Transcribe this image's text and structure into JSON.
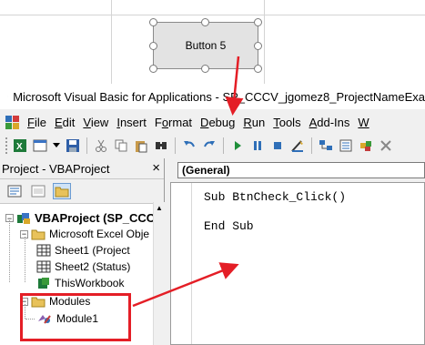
{
  "excel": {
    "button_label": "Button 5"
  },
  "vbe": {
    "title": "Microsoft Visual Basic for Applications - SP_CCCV_jgomez8_ProjectNameExa",
    "menu": [
      {
        "label": "File",
        "accel": "F",
        "rest": "ile"
      },
      {
        "label": "Edit",
        "accel": "E",
        "rest": "dit"
      },
      {
        "label": "View",
        "accel": "V",
        "rest": "iew"
      },
      {
        "label": "Insert",
        "accel": "I",
        "rest": "nsert"
      },
      {
        "label": "Format",
        "accel": "o",
        "pre": "F",
        "rest": "rmat"
      },
      {
        "label": "Debug",
        "accel": "D",
        "rest": "ebug"
      },
      {
        "label": "Run",
        "accel": "R",
        "rest": "un"
      },
      {
        "label": "Tools",
        "accel": "T",
        "rest": "ools"
      },
      {
        "label": "Add-Ins",
        "accel": "A",
        "rest": "dd-Ins"
      }
    ],
    "menu_overflow": "W",
    "project_pane": {
      "title": "Project - VBAProject",
      "close": "×",
      "tree": {
        "root": "VBAProject (SP_CCCV",
        "folder_excel": "Microsoft Excel Obje",
        "sheet1": "Sheet1 (Project",
        "sheet2": "Sheet2 (Status)",
        "thisworkbook": "ThisWorkbook",
        "folder_modules": "Modules",
        "module1": "Module1"
      }
    },
    "code_pane": {
      "object_combo": "(General)",
      "lines": [
        "Sub BtnCheck_Click()",
        "",
        "End Sub"
      ]
    }
  },
  "colors": {
    "annotation_red": "#e41e26",
    "folder_yellow": "#e8c25a"
  }
}
